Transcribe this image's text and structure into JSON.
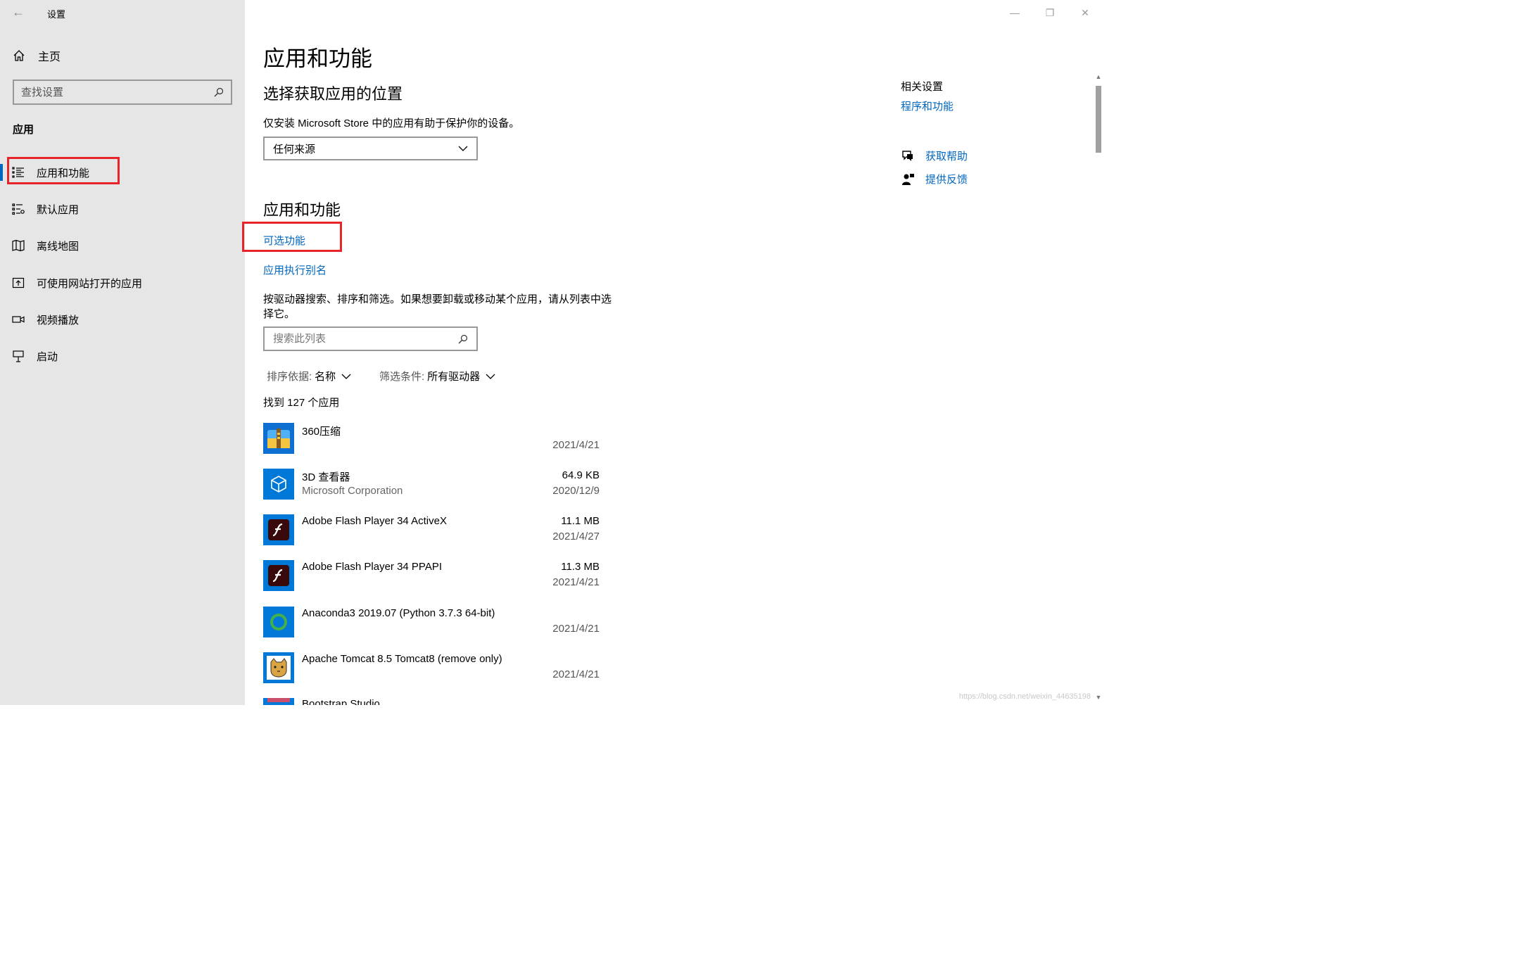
{
  "window": {
    "title": "设置",
    "back_glyph": "←",
    "controls": {
      "minimize": "—",
      "maximize": "❐",
      "close": "✕"
    }
  },
  "sidebar": {
    "home_label": "主页",
    "search_placeholder": "查找设置",
    "section_title": "应用",
    "items": [
      {
        "label": "应用和功能",
        "icon": "apps-features-icon",
        "active": true
      },
      {
        "label": "默认应用",
        "icon": "default-apps-icon"
      },
      {
        "label": "离线地图",
        "icon": "offline-maps-icon"
      },
      {
        "label": "可使用网站打开的应用",
        "icon": "apps-for-websites-icon"
      },
      {
        "label": "视频播放",
        "icon": "video-playback-icon"
      },
      {
        "label": "启动",
        "icon": "startup-icon"
      }
    ]
  },
  "main": {
    "page_title": "应用和功能",
    "install_section": {
      "heading": "选择获取应用的位置",
      "description": "仅安装 Microsoft Store 中的应用有助于保护你的设备。",
      "dropdown_value": "任何来源"
    },
    "apps_section": {
      "heading": "应用和功能",
      "link_optional_features": "可选功能",
      "link_app_aliases": "应用执行别名",
      "description": "按驱动器搜索、排序和筛选。如果想要卸载或移动某个应用，请从列表中选择它。",
      "search_placeholder": "搜索此列表",
      "sort_label": "排序依据:",
      "sort_value": "名称",
      "filter_label": "筛选条件:",
      "filter_value": "所有驱动器",
      "count_text": "找到 127 个应用"
    },
    "apps": [
      {
        "name": "360压缩",
        "publisher": "",
        "size": "",
        "date": "2021/4/21",
        "icon": "360-zip-icon"
      },
      {
        "name": "3D 查看器",
        "publisher": "Microsoft Corporation",
        "size": "64.9 KB",
        "date": "2020/12/9",
        "icon": "3d-viewer-icon"
      },
      {
        "name": "Adobe Flash Player 34 ActiveX",
        "publisher": "",
        "size": "11.1 MB",
        "date": "2021/4/27",
        "icon": "flash-player-icon"
      },
      {
        "name": "Adobe Flash Player 34 PPAPI",
        "publisher": "",
        "size": "11.3 MB",
        "date": "2021/4/21",
        "icon": "flash-player-icon"
      },
      {
        "name": "Anaconda3 2019.07 (Python 3.7.3 64-bit)",
        "publisher": "",
        "size": "",
        "date": "2021/4/21",
        "icon": "anaconda-icon"
      },
      {
        "name": "Apache Tomcat 8.5 Tomcat8 (remove only)",
        "publisher": "",
        "size": "",
        "date": "2021/4/21",
        "icon": "tomcat-icon"
      },
      {
        "name": "Bootstrap Studio",
        "publisher": "",
        "size": "",
        "date": "",
        "icon": "bootstrap-studio-icon"
      }
    ]
  },
  "related": {
    "title": "相关设置",
    "link_programs": "程序和功能",
    "link_help": "获取帮助",
    "link_feedback": "提供反馈"
  },
  "watermark": "https://blog.csdn.net/weixin_44635198",
  "colors": {
    "accent": "#0067c0",
    "highlight_box": "#e8242b",
    "sidebar_bg": "#e6e6e6"
  }
}
